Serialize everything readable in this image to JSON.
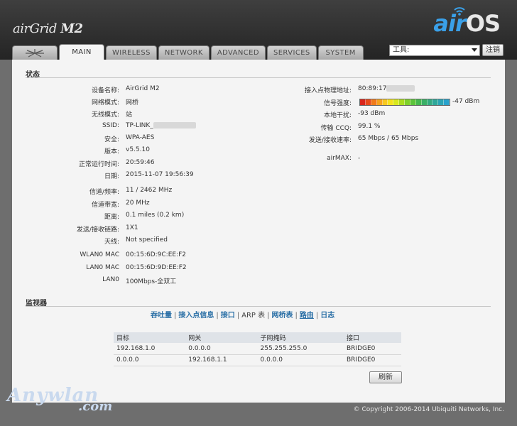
{
  "header": {
    "brand_left_light": "air",
    "brand_left_mid": "Grid",
    "brand_left_bold": "M2",
    "brand_right_air": "air",
    "brand_right_os": "OS"
  },
  "tabs": [
    {
      "label": "MAIN",
      "active": true
    },
    {
      "label": "WIRELESS"
    },
    {
      "label": "NETWORK"
    },
    {
      "label": "ADVANCED"
    },
    {
      "label": "SERVICES"
    },
    {
      "label": "SYSTEM"
    }
  ],
  "tools": {
    "selected": "工具:",
    "logout_label": "注销"
  },
  "status": {
    "title": "状态",
    "left": [
      {
        "label": "设备名称:",
        "value": "AirGrid M2"
      },
      {
        "label": "网络模式:",
        "value": "网桥"
      },
      {
        "label": "无线模式:",
        "value": "站"
      },
      {
        "label": "SSID:",
        "value": "TP-LINK_"
      },
      {
        "label": "安全:",
        "value": "WPA-AES"
      },
      {
        "label": "版本:",
        "value": "v5.5.10"
      },
      {
        "label": "正常运行时间:",
        "value": "20:59:46"
      },
      {
        "label": "日期:",
        "value": "2015-11-07 19:56:39"
      },
      {
        "label": "信道/频率:",
        "value": "11 / 2462 MHz"
      },
      {
        "label": "信道带宽:",
        "value": "20 MHz"
      },
      {
        "label": "距离:",
        "value": "0.1 miles (0.2 km)"
      },
      {
        "label": "发送/接收链路:",
        "value": "1X1"
      },
      {
        "label": "天线:",
        "value": "Not specified"
      },
      {
        "label": "WLAN0 MAC",
        "value": "00:15:6D:9C:EE:F2"
      },
      {
        "label": "LAN0 MAC",
        "value": "00:15:6D:9D:EE:F2"
      },
      {
        "label": "LAN0",
        "value": "100Mbps-全双工"
      }
    ],
    "right": [
      {
        "label": "接入点物理地址:",
        "value": "80:89:17"
      },
      {
        "label": "信号强度:",
        "value": "-47 dBm"
      },
      {
        "label": "本地干扰:",
        "value": "-93 dBm"
      },
      {
        "label": "传输 CCQ:",
        "value": "99.1 %"
      },
      {
        "label": "发送/接收速率:",
        "value": "65 Mbps / 65 Mbps"
      },
      {
        "label": "airMAX:",
        "value": "-"
      }
    ],
    "signal_fraction": 1.0,
    "signal_colors": [
      "#d9261c",
      "#e84a1a",
      "#f07a1a",
      "#f5a21e",
      "#f7c81f",
      "#f5e21c",
      "#d8e81c",
      "#a9dc1e",
      "#7fd02a",
      "#5cc43a",
      "#45b84e",
      "#3aaf66",
      "#34aa80",
      "#2fa79a",
      "#2ca4b4",
      "#29a2cc"
    ]
  },
  "monitor": {
    "title": "监视器",
    "links": [
      {
        "label": "吞吐量"
      },
      {
        "label": "接入点信息"
      },
      {
        "label": "接口"
      },
      {
        "label": "ARP 表",
        "current": true
      },
      {
        "label": "网桥表"
      },
      {
        "label": "路由",
        "underlined": true
      },
      {
        "label": "日志"
      }
    ],
    "table": {
      "headers": [
        "目标",
        "网关",
        "子网掩码",
        "接口"
      ],
      "rows": [
        [
          "192.168.1.0",
          "0.0.0.0",
          "255.255.255.0",
          "BRIDGE0"
        ],
        [
          "0.0.0.0",
          "192.168.1.1",
          "0.0.0.0",
          "BRIDGE0"
        ]
      ]
    },
    "refresh_label": "刷新"
  },
  "footer": {
    "copyright": "© Copyright 2006-2014 Ubiquiti Networks, Inc.",
    "watermark_top": "Anywlan",
    "watermark_bottom": ".com"
  }
}
